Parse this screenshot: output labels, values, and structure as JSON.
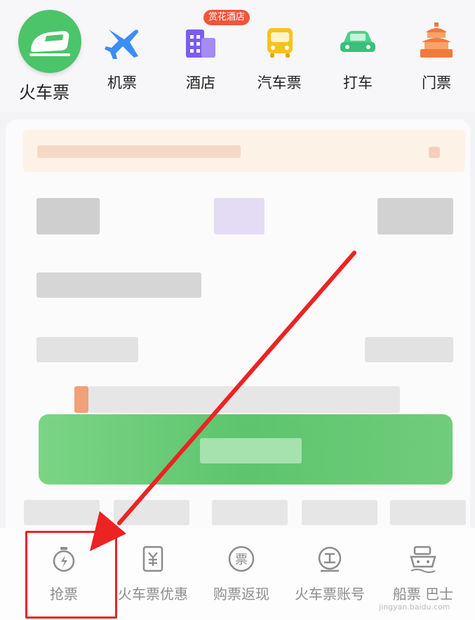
{
  "top_nav": {
    "items": [
      {
        "label": "火车票",
        "icon": "train-icon"
      },
      {
        "label": "机票",
        "icon": "airplane-icon"
      },
      {
        "label": "酒店",
        "icon": "hotel-icon",
        "badge": "赏花酒店"
      },
      {
        "label": "汽车票",
        "icon": "bus-icon"
      },
      {
        "label": "打车",
        "icon": "car-icon"
      },
      {
        "label": "门票",
        "icon": "temple-icon"
      }
    ]
  },
  "toolbar": {
    "items": [
      {
        "label": "抢票",
        "icon": "stopwatch-icon"
      },
      {
        "label": "火车票优惠",
        "icon": "coupon-icon"
      },
      {
        "label": "购票返现",
        "icon": "ticket-cashback-icon"
      },
      {
        "label": "火车票账号",
        "icon": "account-icon"
      },
      {
        "label": "船票 巴士",
        "icon": "ship-bus-icon"
      }
    ]
  },
  "watermark": "jingyan.baidu.com",
  "colors": {
    "accent_green": "#4bc46a",
    "annotation_red": "#ec2323",
    "badge_red": "#f2553a"
  }
}
